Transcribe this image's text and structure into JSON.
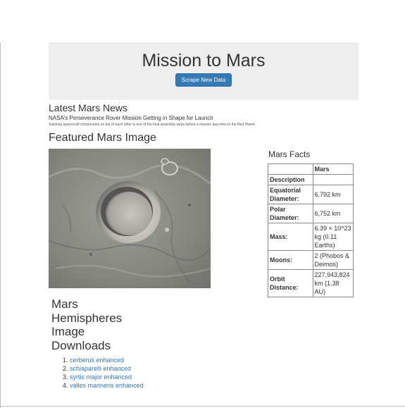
{
  "jumbotron": {
    "title": "Mission to Mars",
    "button_label": "Scrape New Data"
  },
  "news": {
    "heading": "Latest Mars News",
    "title": "NASA's Perseverance Rover Mission Getting in Shape for Launch",
    "teaser": "Stacking spacecraft components on top of each other is one of the final assembly steps before a mission launches to the Red Planet."
  },
  "featured": {
    "heading": "Featured Mars Image"
  },
  "facts": {
    "heading": "Mars Facts",
    "column_header": "Mars",
    "rows": [
      {
        "label": "Description",
        "value": ""
      },
      {
        "label": "Equatorial Diameter:",
        "value": "6,792 km"
      },
      {
        "label": "Polar Diameter:",
        "value": "6,752 km"
      },
      {
        "label": "Mass:",
        "value": "6.39 × 10^23 kg (0.11 Earths)"
      },
      {
        "label": "Moons:",
        "value": "2 (Phobos & Deimos)"
      },
      {
        "label": "Orbit Distance:",
        "value": "227,943,824 km (1.38 AU)"
      }
    ]
  },
  "hemispheres": {
    "heading": "Mars Hemispheres Image Downloads",
    "links": [
      "cerberus enhanced",
      "schiaparelli enhanced",
      "syrtis major enhanced",
      "valles marineris enhanced"
    ]
  }
}
